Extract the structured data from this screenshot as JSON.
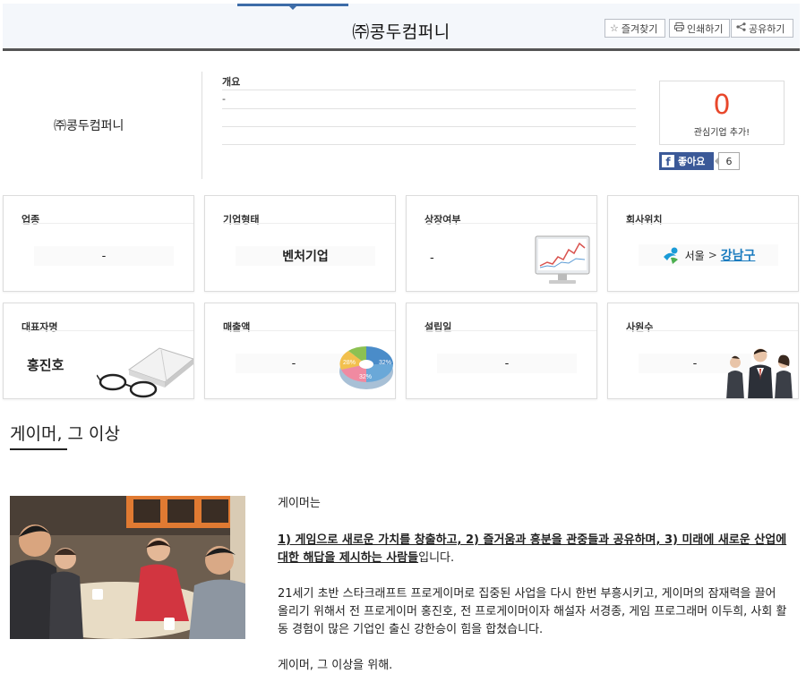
{
  "header": {
    "title": "㈜콩두컴퍼니",
    "buttons": [
      {
        "icon": "star-icon",
        "label": "즐겨찾기"
      },
      {
        "icon": "printer-icon",
        "label": "인쇄하기"
      },
      {
        "icon": "share-icon",
        "label": "공유하기"
      }
    ]
  },
  "profile": {
    "company_name": "㈜콩두컴퍼니",
    "overview_label": "개요",
    "overview_text": "-",
    "interest_count": "0",
    "interest_label": "관심기업 추가!",
    "like_label": "좋아요",
    "like_count": "6"
  },
  "cards": [
    {
      "title": "업종",
      "value": "-"
    },
    {
      "title": "기업형태",
      "value": "벤처기업"
    },
    {
      "title": "상장여부",
      "value": "-"
    },
    {
      "title": "회사위치",
      "region": "서울",
      "separator": ">",
      "district": "강남구"
    },
    {
      "title": "대표자명",
      "value": "홍진호"
    },
    {
      "title": "매출액",
      "value": "-"
    },
    {
      "title": "설립일",
      "value": "-"
    },
    {
      "title": "사원수",
      "value": "-"
    }
  ],
  "pie_labels": [
    "32%",
    "32%",
    "28%"
  ],
  "section": {
    "title": "게이머, 그 이상"
  },
  "description": {
    "intro": "게이머는",
    "highlight": "1) 게임으로 새로운 가치를 창출하고, 2) 즐거움과 흥분을 관중들과 공유하며, 3) 미래에 새로운 산업에 대한 해답을 제시하는 사람들",
    "highlight_suffix": "입니다.",
    "body": "21세기 초반 스타크래프트 프로게이머로 집중된 사업을 다시 한번 부흥시키고, 게이머의 잠재력을 끌어 올리기 위해서 전 프로게이머 홍진호, 전 프로게이머이자 해설자 서경종, 게임 프로그래머 이두희, 사회 활동 경험이 많은 기업인 출신 강한승이 힘을 합쳤습니다.",
    "closing": "게이머, 그 이상을 위해."
  },
  "colors": {
    "accent": "#3d6ca8",
    "interest": "#e8472b",
    "facebook": "#3b5998",
    "link": "#1a7bbf"
  }
}
